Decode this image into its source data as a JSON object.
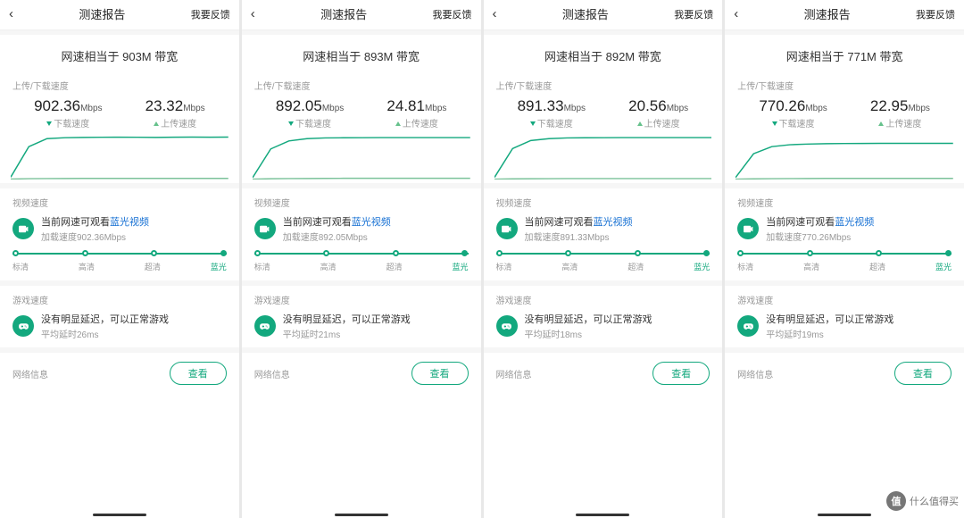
{
  "common": {
    "title": "测速报告",
    "feedback": "我要反馈",
    "summary_prefix": "网速相当于 ",
    "summary_suffix": " 带宽",
    "updown_label": "上传/下载速度",
    "mbps": "Mbps",
    "download_label": "下载速度",
    "upload_label": "上传速度",
    "video_section": "视频速度",
    "video_line_prefix": "当前网速可观看",
    "video_highlight": "蓝光视频",
    "video_load_prefix": "加载速度",
    "scale": [
      "标清",
      "高清",
      "超清",
      "蓝光"
    ],
    "game_section": "游戏速度",
    "game_line": "没有明显延迟，可以正常游戏",
    "latency_prefix": "平均延时",
    "network_info": "网络信息",
    "view": "查看"
  },
  "panels": [
    {
      "bw": "903M",
      "dl": "902.36",
      "ul": "23.32",
      "loadspeed": "902.36Mbps",
      "latency": "26ms"
    },
    {
      "bw": "893M",
      "dl": "892.05",
      "ul": "24.81",
      "loadspeed": "892.05Mbps",
      "latency": "21ms"
    },
    {
      "bw": "892M",
      "dl": "891.33",
      "ul": "20.56",
      "loadspeed": "891.33Mbps",
      "latency": "18ms"
    },
    {
      "bw": "771M",
      "dl": "770.26",
      "ul": "22.95",
      "loadspeed": "770.26Mbps",
      "latency": "19ms"
    }
  ],
  "chart_data": [
    {
      "type": "line",
      "title": "",
      "xlabel": "",
      "ylabel": "Mbps",
      "ylim": [
        0,
        950
      ],
      "series": [
        {
          "name": "下载速度",
          "values": [
            50,
            700,
            870,
            890,
            895,
            898,
            900,
            898,
            895,
            900,
            902,
            900,
            902
          ]
        },
        {
          "name": "上传速度",
          "values": [
            10,
            18,
            21,
            22,
            23,
            23,
            23,
            23,
            23,
            23,
            23,
            23,
            23
          ]
        }
      ]
    },
    {
      "type": "line",
      "title": "",
      "xlabel": "",
      "ylabel": "Mbps",
      "ylim": [
        0,
        950
      ],
      "series": [
        {
          "name": "下载速度",
          "values": [
            40,
            650,
            820,
            870,
            885,
            888,
            890,
            891,
            892,
            892,
            892,
            892,
            892
          ]
        },
        {
          "name": "上传速度",
          "values": [
            8,
            16,
            20,
            22,
            24,
            25,
            25,
            25,
            25,
            25,
            25,
            25,
            25
          ]
        }
      ]
    },
    {
      "type": "line",
      "title": "",
      "xlabel": "",
      "ylabel": "Mbps",
      "ylim": [
        0,
        950
      ],
      "series": [
        {
          "name": "下载速度",
          "values": [
            45,
            660,
            830,
            870,
            885,
            888,
            890,
            891,
            891,
            891,
            891,
            891,
            891
          ]
        },
        {
          "name": "上传速度",
          "values": [
            8,
            14,
            17,
            19,
            20,
            21,
            21,
            21,
            21,
            21,
            21,
            21,
            21
          ]
        }
      ]
    },
    {
      "type": "line",
      "title": "",
      "xlabel": "",
      "ylabel": "Mbps",
      "ylim": [
        0,
        950
      ],
      "series": [
        {
          "name": "下载速度",
          "values": [
            40,
            550,
            700,
            740,
            755,
            762,
            766,
            768,
            769,
            770,
            770,
            770,
            770
          ]
        },
        {
          "name": "上传速度",
          "values": [
            8,
            15,
            19,
            21,
            22,
            23,
            23,
            23,
            23,
            23,
            23,
            23,
            23
          ]
        }
      ]
    }
  ],
  "watermark": {
    "badge": "值",
    "text": "什么值得买"
  }
}
